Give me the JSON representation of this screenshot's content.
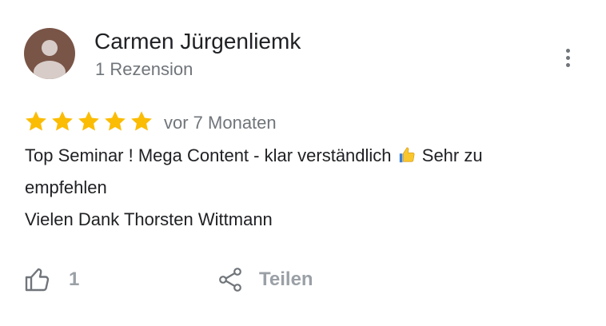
{
  "reviewer": {
    "name": "Carmen Jürgenliemk",
    "review_count": "1 Rezension",
    "avatar_icon": "person-silhouette",
    "avatar_color": "#795548"
  },
  "menu": {
    "icon": "more-vert-icon"
  },
  "rating": {
    "stars": 5,
    "max_stars": 5,
    "star_color": "#fbbc04",
    "date": "vor 7 Monaten"
  },
  "review": {
    "line1_before_emoji": "Top Seminar ! Mega Content - klar verständlich",
    "emoji": "thumbs-up",
    "line1_after_emoji": "Sehr zu",
    "line2": "empfehlen",
    "line3": "Vielen Dank Thorsten Wittmann"
  },
  "actions": {
    "like_icon": "thumb-up-outline-icon",
    "like_count": "1",
    "share_icon": "share-icon",
    "share_label": "Teilen"
  }
}
